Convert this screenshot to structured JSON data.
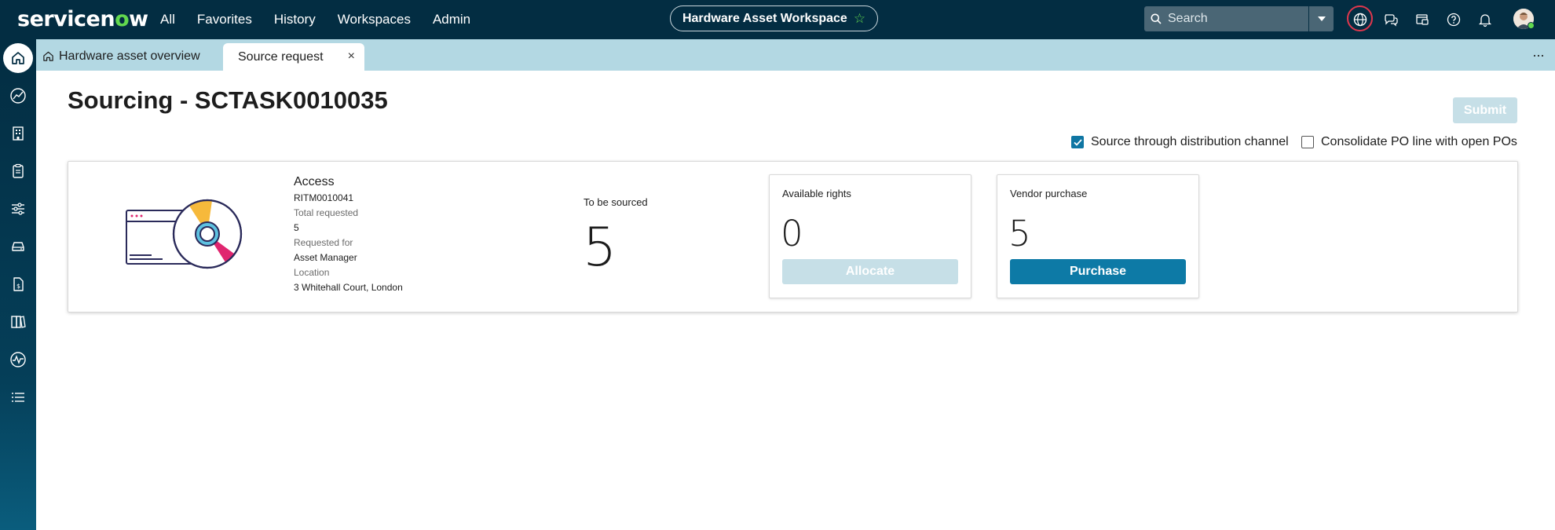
{
  "brand": {
    "logo_pre": "servicen",
    "logo_o": "o",
    "logo_post": "w"
  },
  "topnav": {
    "menu": [
      "All",
      "Favorites",
      "History",
      "Workspaces",
      "Admin"
    ],
    "workspace_title": "Hardware Asset Workspace",
    "search_placeholder": "Search",
    "icons": [
      "globe-icon",
      "chat-icon",
      "workspace-badge-icon",
      "help-icon",
      "bell-icon"
    ]
  },
  "sidebar": {
    "items": [
      "home-icon",
      "analytics-icon",
      "building-icon",
      "clipboard-icon",
      "sliders-icon",
      "drive-icon",
      "contract-icon",
      "catalog-icon",
      "activity-icon",
      "list-icon"
    ]
  },
  "tabs": {
    "overview_label": "Hardware asset overview",
    "active_label": "Source request",
    "close_glyph": "×",
    "more_glyph": "···"
  },
  "page": {
    "title": "Sourcing - SCTASK0010035",
    "submit_label": "Submit",
    "option_distribution": {
      "label": "Source through distribution channel",
      "checked": true
    },
    "option_consolidate": {
      "label": "Consolidate PO line with open POs",
      "checked": false
    }
  },
  "item": {
    "name": "Access",
    "request_id": "RITM0010041",
    "total_requested_label": "Total requested",
    "total_requested": "5",
    "requested_for_label": "Requested for",
    "requested_for": "Asset Manager",
    "location_label": "Location",
    "location": "3 Whitehall Court, London",
    "to_be_sourced_label": "To be sourced",
    "to_be_sourced": "5"
  },
  "available_rights": {
    "label": "Available rights",
    "value": "0",
    "button_label": "Allocate"
  },
  "vendor_purchase": {
    "label": "Vendor purchase",
    "value": "5",
    "button_label": "Purchase"
  },
  "colors": {
    "nav_bg": "#032d42",
    "accent": "#0d7aa6",
    "tab_bar": "#b3d8e3",
    "disabled_btn": "#c6dfe7",
    "brand_green": "#62d84e"
  }
}
